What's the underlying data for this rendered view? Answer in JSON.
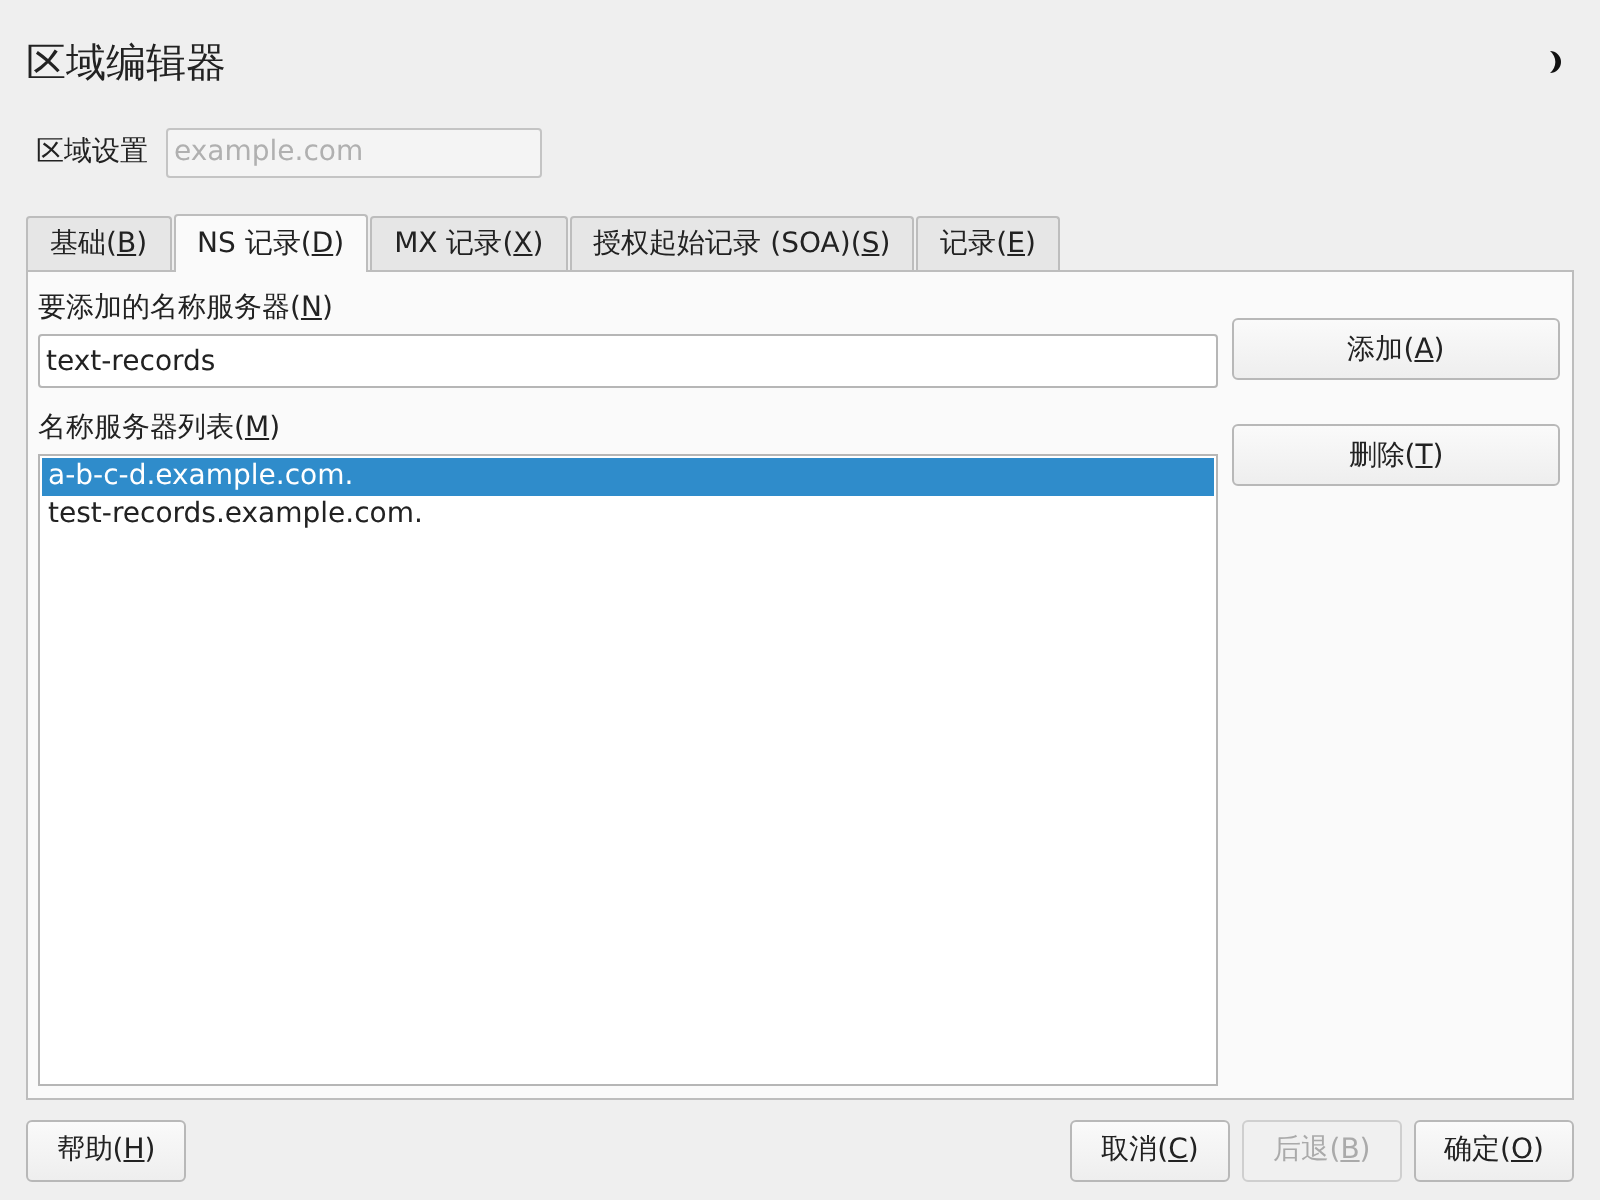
{
  "window": {
    "title": "区域编辑器"
  },
  "zone_settings": {
    "label": "区域设置",
    "placeholder": "example.com"
  },
  "tabs": [
    {
      "label": "基础(B)",
      "selected": false
    },
    {
      "label": "NS 记录(D)",
      "selected": true
    },
    {
      "label": "MX 记录(X)",
      "selected": false
    },
    {
      "label": "授权起始记录 (SOA)(S)",
      "selected": false
    },
    {
      "label": "记录(E)",
      "selected": false
    }
  ],
  "name_server_to_add": {
    "label": "要添加的名称服务器(N)",
    "value": "text-records"
  },
  "add_button": {
    "label": "添加(A)"
  },
  "name_server_list": {
    "label": "名称服务器列表(M)",
    "items": [
      {
        "text": "a-b-c-d.example.com.",
        "selected": true
      },
      {
        "text": "test-records.example.com.",
        "selected": false
      }
    ]
  },
  "delete_button": {
    "label": "删除(T)"
  },
  "footer_left_buttons": [
    {
      "label": "帮助(H)",
      "disabled": false
    }
  ],
  "footer_right_buttons": [
    {
      "label": "取消(C)",
      "disabled": false
    },
    {
      "label": "后退(B)",
      "disabled": true
    },
    {
      "label": "确定(O)",
      "disabled": false
    }
  ]
}
